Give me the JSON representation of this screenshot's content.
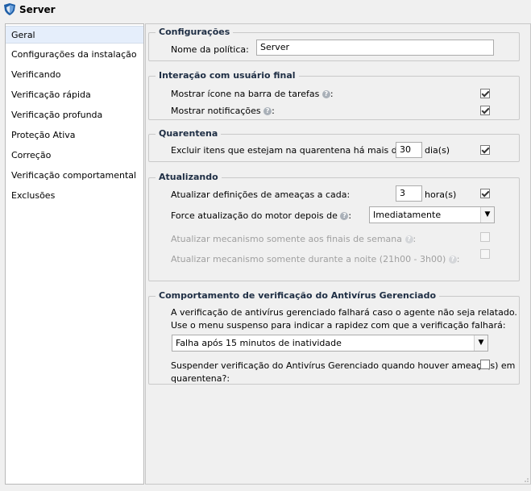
{
  "window": {
    "title": "Server",
    "logo_icon": "shield-logo-icon"
  },
  "sidebar": {
    "items": [
      {
        "label": "Geral",
        "selected": true
      },
      {
        "label": "Configurações da instalação",
        "selected": false
      },
      {
        "label": "Verificando",
        "selected": false
      },
      {
        "label": "Verificação rápida",
        "selected": false
      },
      {
        "label": "Verificação profunda",
        "selected": false
      },
      {
        "label": "Proteção Ativa",
        "selected": false
      },
      {
        "label": "Correção",
        "selected": false
      },
      {
        "label": "Verificação comportamental",
        "selected": false
      },
      {
        "label": "Exclusões",
        "selected": false
      }
    ]
  },
  "configuracoes": {
    "legend": "Configurações",
    "policy_name_label": "Nome da política:",
    "policy_name_value": "Server"
  },
  "interacao": {
    "legend": "Interação com usuário final",
    "show_tray_icon_label": "Mostrar ícone na barra de tarefas",
    "show_tray_icon_suffix": ":",
    "show_tray_icon_checked": true,
    "show_notifications_label": "Mostrar notificações",
    "show_notifications_suffix": ":",
    "show_notifications_checked": true
  },
  "quarentena": {
    "legend": "Quarentena",
    "exclude_label": "Excluir itens que estejam na quarentena há mais de:",
    "exclude_value": "30",
    "exclude_unit": "dia(s)",
    "exclude_checked": true
  },
  "atualizando": {
    "legend": "Atualizando",
    "update_defs_label": "Atualizar definições de ameaças a cada:",
    "update_defs_value": "3",
    "update_defs_unit": "hora(s)",
    "update_defs_checked": true,
    "force_engine_label": "Force atualização do motor depois de",
    "force_engine_suffix": ":",
    "force_engine_selected": "Imediatamente",
    "weekends_label": "Atualizar mecanismo somente aos finais de semana",
    "weekends_suffix": ":",
    "weekends_checked": false,
    "night_label": "Atualizar mecanismo somente durante a noite (21h00 - 3h00)",
    "night_suffix": ":",
    "night_checked": false
  },
  "comportamento": {
    "legend": "Comportamento de verificação do Antivírus Gerenciado",
    "desc_line1": "A verificação de antivírus gerenciado falhará caso o agente não seja relatado.",
    "desc_line2": "Use o menu suspenso para indicar a rapidez com que a verificação falhará:",
    "fail_selected": "Falha após 15 minutos de inatividade",
    "suspend_line1": "Suspender verificação do Antivírus Gerenciado quando houver ameaça(s) em",
    "suspend_line2": "quarentena?:",
    "suspend_checked": false
  },
  "colors": {
    "accent_selected": "#e5eefb",
    "legend_text": "#1e2e44",
    "help_icon": "#a9b0b8"
  }
}
